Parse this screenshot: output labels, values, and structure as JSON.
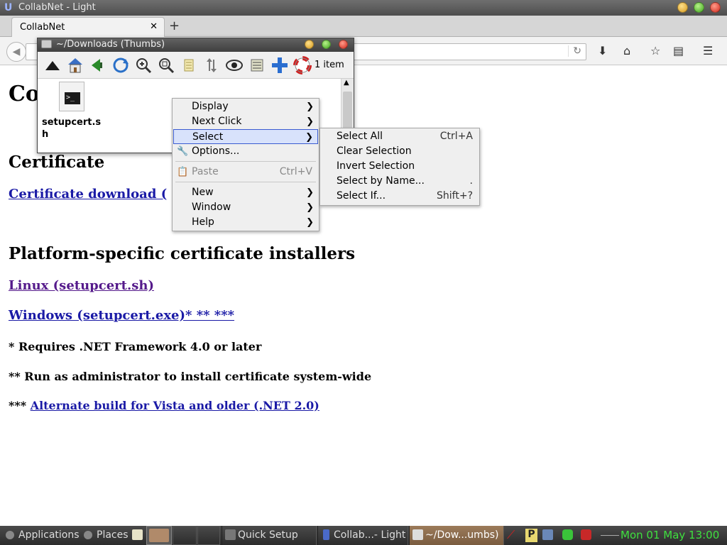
{
  "window": {
    "title": "CollabNet - Light"
  },
  "tabs": [
    {
      "label": "CollabNet"
    }
  ],
  "page": {
    "heading_partial": "Co",
    "section1": {
      "heading": "Certificate",
      "link": "Certificate download ("
    },
    "section2": {
      "heading": "Platform-specific certificate installers",
      "linux_link": "Linux (setupcert.sh)",
      "windows_link": "Windows (setupcert.exe)* ** ***",
      "note1": "* Requires .NET Framework 4.0 or later",
      "note2": "** Run as administrator to install certificate system-wide",
      "note3_prefix": "*** ",
      "note3_link": "Alternate build for Vista and older (.NET 2.0)"
    }
  },
  "file_manager": {
    "title": "~/Downloads (Thumbs)",
    "item_count": "1 item",
    "file": {
      "name": "setupcert.sh",
      "icon_text": ">_"
    }
  },
  "context_menu": {
    "items": [
      {
        "label": "Display"
      },
      {
        "label": "Next Click"
      },
      {
        "label": "Select"
      },
      {
        "label": "Options..."
      },
      {
        "label": "Paste",
        "accel": "Ctrl+V"
      },
      {
        "label": "New"
      },
      {
        "label": "Window"
      },
      {
        "label": "Help"
      }
    ]
  },
  "select_submenu": {
    "items": [
      {
        "label": "Select All",
        "accel": "Ctrl+A"
      },
      {
        "label": "Clear Selection",
        "accel": ""
      },
      {
        "label": "Invert Selection",
        "accel": ""
      },
      {
        "label": "Select by Name...",
        "accel": "."
      },
      {
        "label": "Select If...",
        "accel": "Shift+?"
      }
    ]
  },
  "taskbar": {
    "applications": "Applications",
    "places": "Places",
    "tasks": [
      {
        "label": "Quick Setup"
      },
      {
        "label": "Collab...- Light"
      },
      {
        "label": "~/Dow...umbs)"
      }
    ],
    "clock": "Mon 01 May 13:00"
  },
  "colors": {
    "link": "#1a1aa6",
    "visited": "#551a8b",
    "clock": "#3fe03f",
    "menu_highlight": "#d8e2fb"
  }
}
